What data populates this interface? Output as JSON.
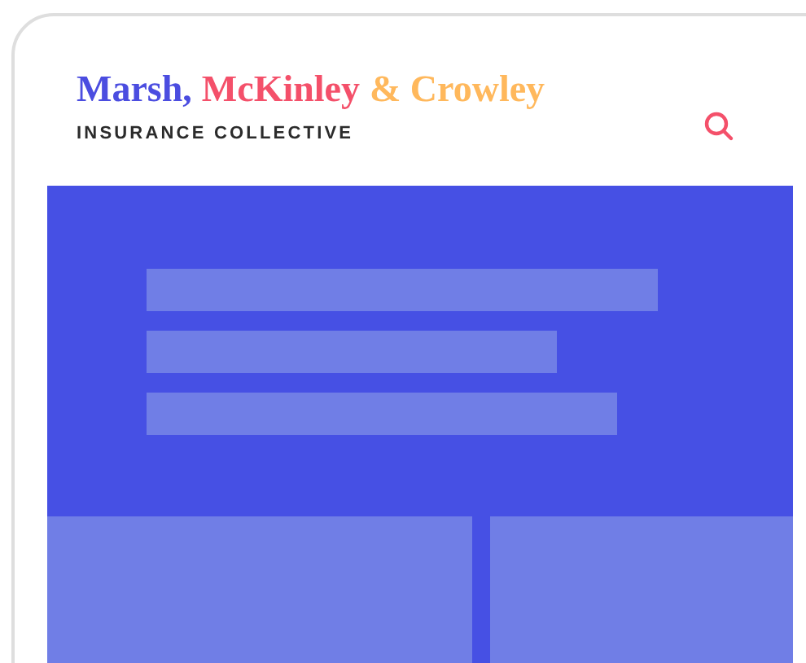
{
  "logo": {
    "parts": [
      {
        "text": "Marsh,",
        "color": "#4b4de0"
      },
      {
        "text": "McKinley",
        "color": "#f4506a"
      },
      {
        "text": "& Crowley",
        "color": "#ffb85c"
      }
    ],
    "tagline": "INSURANCE COLLECTIVE"
  }
}
